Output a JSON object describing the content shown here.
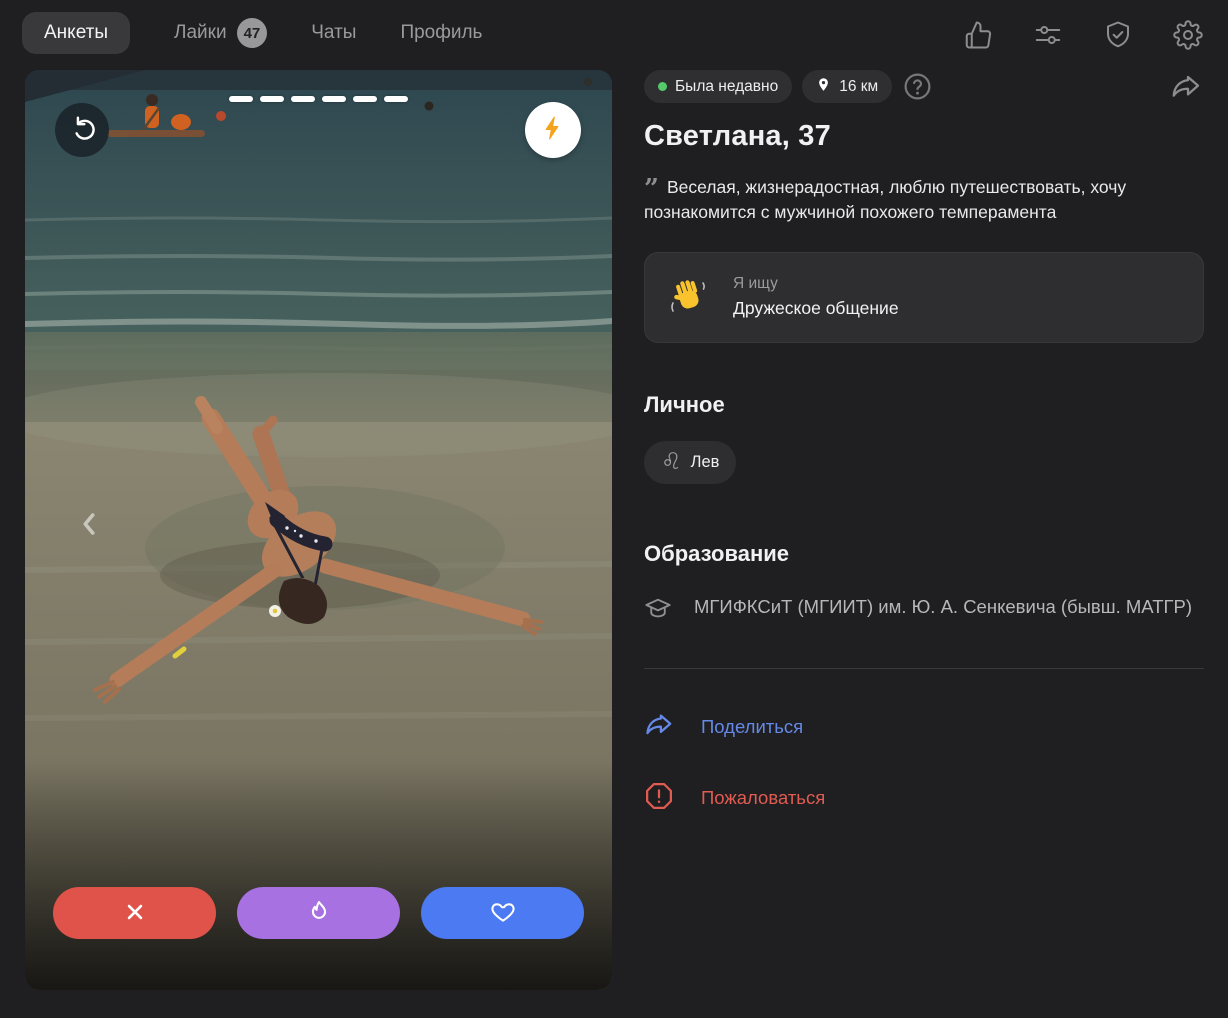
{
  "nav": {
    "tabs": [
      {
        "label": "Анкеты",
        "active": true
      },
      {
        "label": "Лайки",
        "badge": "47"
      },
      {
        "label": "Чаты"
      },
      {
        "label": "Профиль"
      }
    ],
    "icons": {
      "likes": "thumbs-up-icon",
      "filters": "sliders-icon",
      "safety": "shield-check-icon",
      "settings": "gear-icon"
    }
  },
  "photo_card": {
    "progress_segments": 6,
    "rewind_icon": "rotate-ccw-icon",
    "boost_icon": "lightning-icon",
    "prev_icon": "chevron-left-icon",
    "actions": [
      {
        "name": "dislike",
        "icon": "x-icon",
        "color": "#e0534a"
      },
      {
        "name": "superlike",
        "icon": "flame-icon",
        "color": "#a771e2"
      },
      {
        "name": "like",
        "icon": "heart-icon",
        "color": "#4b7af2"
      }
    ]
  },
  "profile": {
    "status": "Была недавно",
    "distance": "16 км",
    "name": "Светлана, 37",
    "quote_mark": "”",
    "quote": "Веселая, жизнерадостная, люблю путешествовать, хочу познакомится с мужчиной похожего темперамента",
    "looking_for": {
      "emoji": "👋",
      "label": "Я ищу",
      "value": "Дружеское общение"
    },
    "personal": {
      "title": "Личное",
      "zodiac_symbol": "♌",
      "zodiac": "Лев"
    },
    "education": {
      "title": "Образование",
      "value": "МГИФКСиТ (МГИИТ) им. Ю. А. Сенкевича (бывш. МАТГР)"
    },
    "links": {
      "share": "Поделиться",
      "report": "Пожаловаться"
    }
  },
  "colors": {
    "background": "#1f1f21",
    "pill_bg": "#2f2f31",
    "active_tab_bg": "#39393b",
    "online_dot": "#56c96b",
    "dislike": "#e0534a",
    "superlike": "#a771e2",
    "like": "#4b7af2",
    "share_link": "#6589e8",
    "report_link": "#e05b51",
    "boost_bolt": "#f5a31c"
  }
}
